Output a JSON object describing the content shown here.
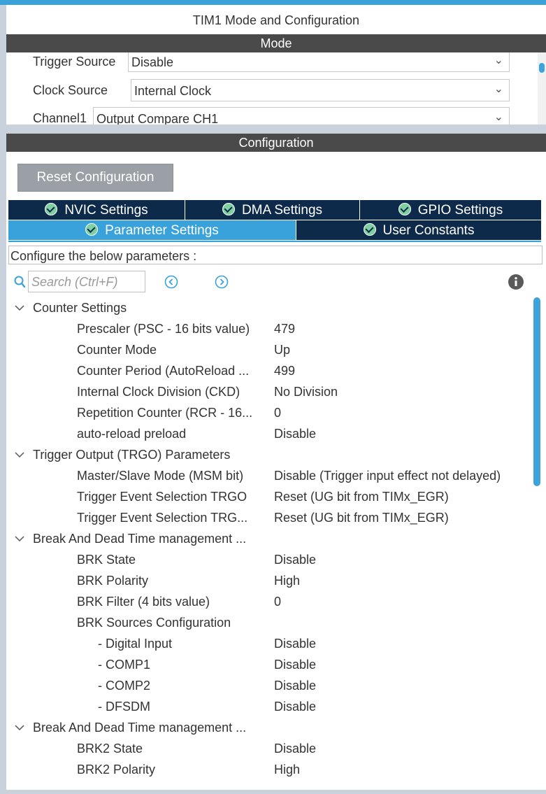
{
  "window": {
    "title": "TIM1 Mode and Configuration"
  },
  "mode": {
    "section_label": "Mode",
    "fields": [
      {
        "label": "Trigger Source",
        "value": "Disable"
      },
      {
        "label": "Clock Source",
        "value": "Internal Clock"
      },
      {
        "label": "Channel1",
        "value": "Output Compare CH1"
      }
    ]
  },
  "configuration": {
    "section_label": "Configuration",
    "reset_label": "Reset Configuration",
    "tabs": [
      {
        "label": "NVIC Settings"
      },
      {
        "label": "DMA Settings"
      },
      {
        "label": "GPIO Settings"
      },
      {
        "label": "Parameter Settings",
        "active": true
      },
      {
        "label": "User Constants"
      }
    ],
    "hint": "Configure the below parameters :",
    "search_placeholder": "Search (Ctrl+F)"
  },
  "params": {
    "counter": {
      "title": "Counter Settings",
      "rows": [
        {
          "name": "Prescaler (PSC - 16 bits value)",
          "value": "479"
        },
        {
          "name": "Counter Mode",
          "value": "Up"
        },
        {
          "name": "Counter Period (AutoReload ...",
          "value": "499"
        },
        {
          "name": "Internal Clock Division (CKD)",
          "value": "No Division"
        },
        {
          "name": "Repetition Counter (RCR - 16...",
          "value": "0"
        },
        {
          "name": "auto-reload preload",
          "value": "Disable"
        }
      ]
    },
    "trgo": {
      "title": "Trigger Output (TRGO) Parameters",
      "rows": [
        {
          "name": "Master/Slave Mode (MSM bit)",
          "value": "Disable (Trigger input effect not delayed)"
        },
        {
          "name": "Trigger Event Selection TRGO",
          "value": "Reset (UG bit from TIMx_EGR)"
        },
        {
          "name": "Trigger Event Selection TRG...",
          "value": "Reset (UG bit from TIMx_EGR)"
        }
      ]
    },
    "break1": {
      "title": "Break And Dead Time management ...",
      "rows": [
        {
          "name": "BRK State",
          "value": "Disable"
        },
        {
          "name": "BRK Polarity",
          "value": "High"
        },
        {
          "name": "BRK Filter (4 bits value)",
          "value": "0"
        },
        {
          "name": "BRK Sources Configuration",
          "value": ""
        },
        {
          "name": "- Digital Input",
          "value": "Disable"
        },
        {
          "name": "- COMP1",
          "value": "Disable"
        },
        {
          "name": "- COMP2",
          "value": "Disable"
        },
        {
          "name": "- DFSDM",
          "value": "Disable"
        }
      ]
    },
    "break2": {
      "title": "Break And Dead Time management ...",
      "rows": [
        {
          "name": "BRK2 State",
          "value": "Disable"
        },
        {
          "name": "BRK2 Polarity",
          "value": "High"
        }
      ]
    }
  },
  "colors": {
    "accent": "#39a2db",
    "tab_dark": "#0d2a4a",
    "section_bar": "#4a4a4a"
  }
}
